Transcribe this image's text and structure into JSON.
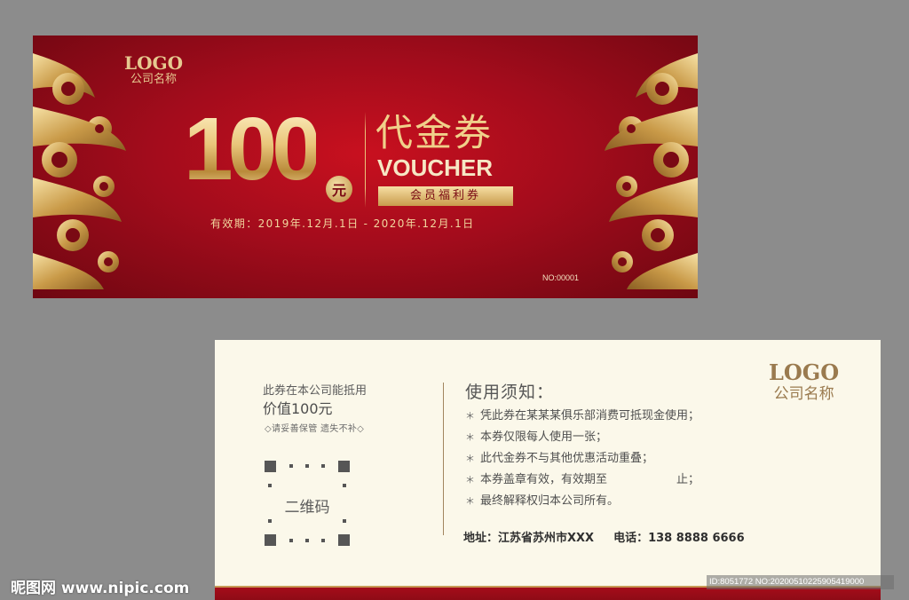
{
  "front": {
    "logo": "LOGO",
    "company": "公司名称",
    "amount": "100",
    "yuan": "元",
    "title_cn": "代金券",
    "title_en": "VOUCHER",
    "member_tag": "会员福利券",
    "validity": "有效期：2019年.12月.1日 - 2020年.12月.1日",
    "serial": "NO:00001",
    "colors": {
      "red": "#a30c1c",
      "gold": "#e9c57a"
    }
  },
  "back": {
    "logo": "LOGO",
    "company": "公司名称",
    "value_line1": "此券在本公司能抵用",
    "value_line2": "价值100元",
    "keep_note": "◇请妥善保管 遗失不补◇",
    "qr_label": "二维码",
    "rules_title": "使用须知：",
    "rules": [
      "凭此券在某某某俱乐部消费可抵现金使用；",
      "本券仅限每人使用一张；",
      "此代金券不与其他优惠活动重叠；",
      "本券盖章有效，有效期至　　　　　　止；",
      "最终解释权归本公司所有。"
    ],
    "bullet": "＊",
    "address": "地址：江苏省苏州市XXX",
    "phone": "电话：138 8888 6666",
    "colors": {
      "cream": "#fbf8ea",
      "brown": "#9a7a4e"
    }
  },
  "watermark": {
    "site": "昵图网 www.nipic.com",
    "id_text": "ID:8051772 NO:20200510225905419000"
  }
}
